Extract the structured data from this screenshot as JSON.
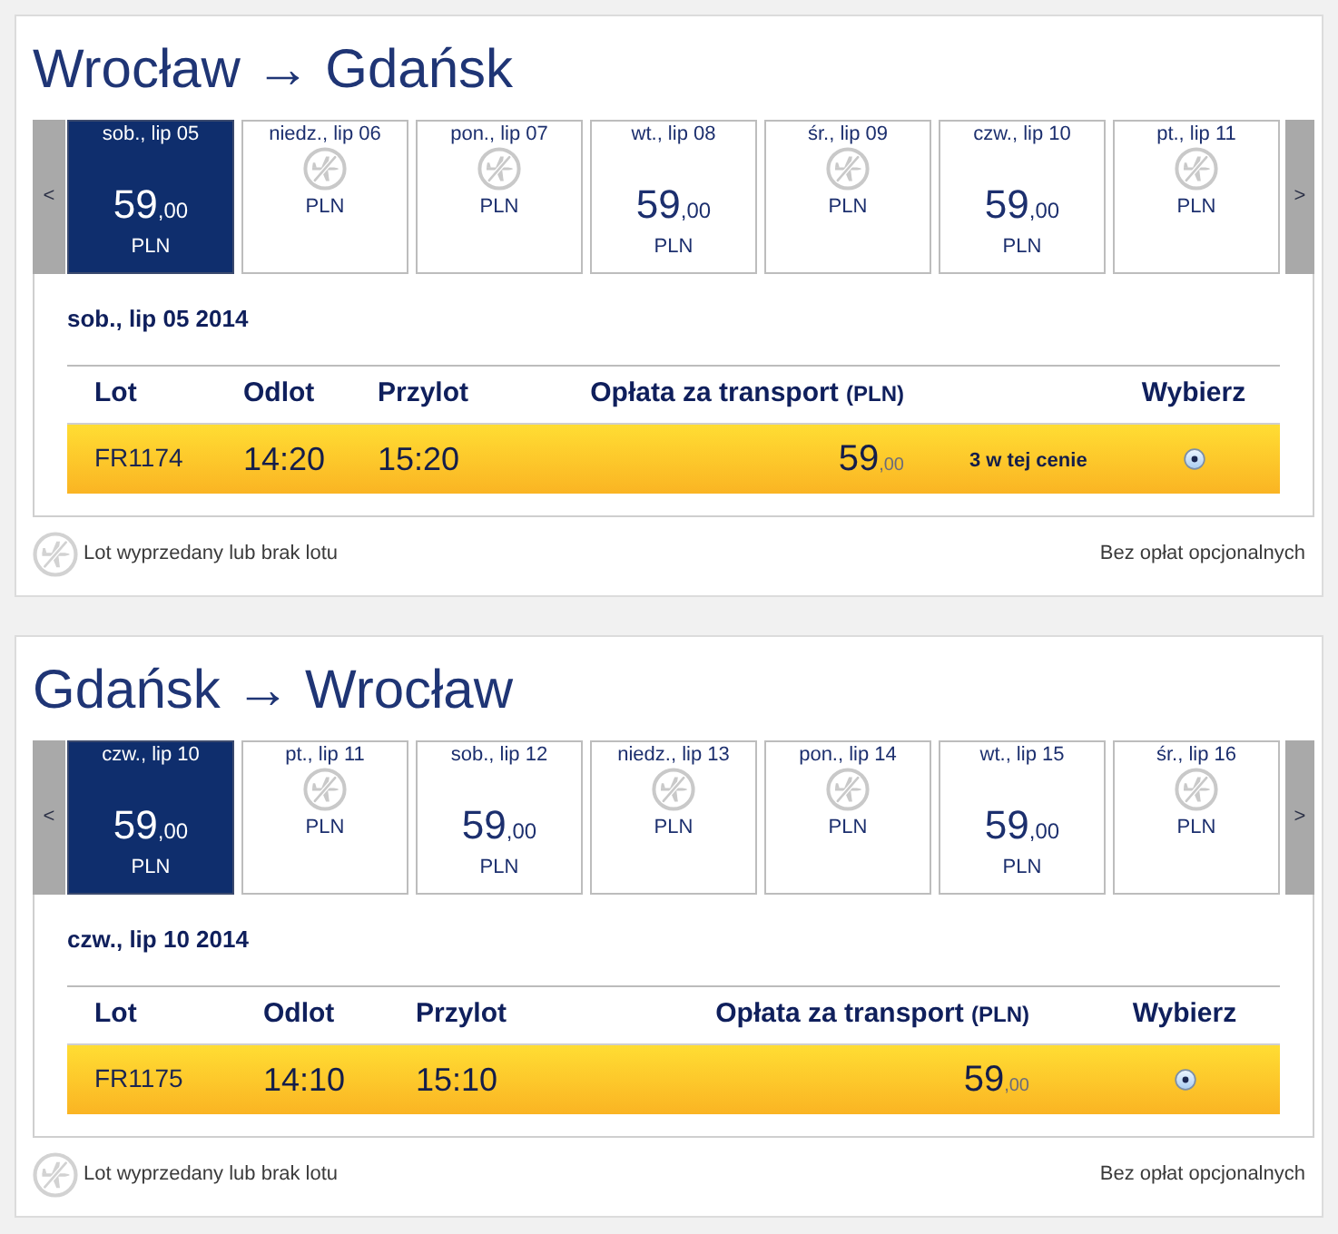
{
  "routes": [
    {
      "title": "Wrocław → Gdańsk",
      "prev": "<",
      "next": ">",
      "days": [
        {
          "kind": "price",
          "date": "sob., lip 05",
          "price": "59",
          "decimals": ",00",
          "currency": "PLN",
          "selected": true
        },
        {
          "kind": "sold_out",
          "date": "niedz., lip 06",
          "currency": "PLN",
          "selected": false
        },
        {
          "kind": "sold_out",
          "date": "pon., lip 07",
          "currency": "PLN",
          "selected": false
        },
        {
          "kind": "price",
          "date": "wt., lip 08",
          "price": "59",
          "decimals": ",00",
          "currency": "PLN",
          "selected": false
        },
        {
          "kind": "sold_out",
          "date": "śr., lip 09",
          "currency": "PLN",
          "selected": false
        },
        {
          "kind": "price",
          "date": "czw., lip 10",
          "price": "59",
          "decimals": ",00",
          "currency": "PLN",
          "selected": false
        },
        {
          "kind": "sold_out",
          "date": "pt., lip 11",
          "currency": "PLN",
          "selected": false
        }
      ],
      "selected_date": "sob., lip 05 2014",
      "table": {
        "columns": {
          "flight": "Lot",
          "departure": "Odlot",
          "arrival": "Przylot",
          "fare": "Opłata za transport",
          "fare_unit": "(PLN)",
          "select": "Wybierz"
        },
        "rows": [
          {
            "flight": "FR1174",
            "departure": "14:20",
            "arrival": "15:20",
            "price": "59",
            "decimals": ",00",
            "note": "3 w tej cenie",
            "selected": true
          }
        ]
      },
      "legend": "Lot wyprzedany lub brak lotu",
      "fees_note": "Bez opłat opcjonalnych"
    },
    {
      "title": "Gdańsk → Wrocław",
      "prev": "<",
      "next": ">",
      "days": [
        {
          "kind": "price",
          "date": "czw., lip 10",
          "price": "59",
          "decimals": ",00",
          "currency": "PLN",
          "selected": true
        },
        {
          "kind": "sold_out",
          "date": "pt., lip 11",
          "currency": "PLN",
          "selected": false
        },
        {
          "kind": "price",
          "date": "sob., lip 12",
          "price": "59",
          "decimals": ",00",
          "currency": "PLN",
          "selected": false
        },
        {
          "kind": "sold_out",
          "date": "niedz., lip 13",
          "currency": "PLN",
          "selected": false
        },
        {
          "kind": "sold_out",
          "date": "pon., lip 14",
          "currency": "PLN",
          "selected": false
        },
        {
          "kind": "price",
          "date": "wt., lip 15",
          "price": "59",
          "decimals": ",00",
          "currency": "PLN",
          "selected": false
        },
        {
          "kind": "sold_out",
          "date": "śr., lip 16",
          "currency": "PLN",
          "selected": false
        }
      ],
      "selected_date": "czw., lip 10 2014",
      "table": {
        "columns": {
          "flight": "Lot",
          "departure": "Odlot",
          "arrival": "Przylot",
          "fare": "Opłata za transport",
          "fare_unit": "(PLN)",
          "select": "Wybierz"
        },
        "rows": [
          {
            "flight": "FR1175",
            "departure": "14:10",
            "arrival": "15:10",
            "price": "59",
            "decimals": ",00",
            "selected": true
          }
        ]
      },
      "legend": "Lot wyprzedany lub brak lotu",
      "fees_note": "Bez opłat opcjonalnych"
    }
  ]
}
